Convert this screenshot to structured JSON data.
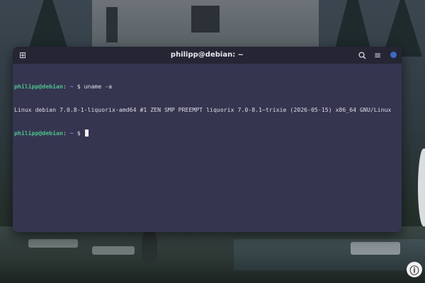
{
  "wallpaper": {
    "badge": "ⓘ"
  },
  "terminal": {
    "title": "philipp@debian: ~",
    "new_tab_icon": "⊞",
    "search_icon": "⚲",
    "menu_icon": "≡",
    "accent_color": "#3c6bc4",
    "lines": [
      {
        "user_host": "philipp@debian",
        "colon": ":",
        "path": " ~",
        "command": " $ uname -a"
      },
      {
        "output": "Linux debian 7.0.8-1-liquorix-amd64 #1 ZEN SMP PREEMPT liquorix 7.0-8.1~trixie (2026-05-15) x86_64 GNU/Linux"
      },
      {
        "user_host": "philipp@debian",
        "colon": ":",
        "path": " ~",
        "command": " $ "
      }
    ]
  }
}
